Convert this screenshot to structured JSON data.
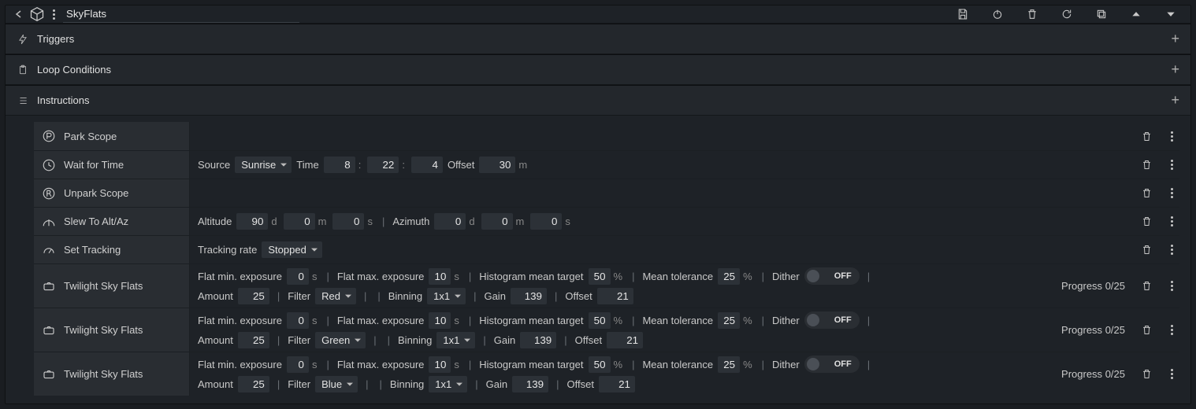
{
  "title": "SkyFlats",
  "sections": {
    "triggers": "Triggers",
    "loop": "Loop Conditions",
    "instructions": "Instructions"
  },
  "labels": {
    "source": "Source",
    "time": "Time",
    "offset": "Offset",
    "altitude": "Altitude",
    "azimuth": "Azimuth",
    "tracking_rate": "Tracking rate",
    "flat_min": "Flat min. exposure",
    "flat_max": "Flat max. exposure",
    "hist_mean": "Histogram mean target",
    "mean_tol": "Mean tolerance",
    "dither": "Dither",
    "amount": "Amount",
    "filter": "Filter",
    "binning": "Binning",
    "gain": "Gain",
    "progress": "Progress",
    "off": "OFF"
  },
  "rows": {
    "park": {
      "title": "Park Scope"
    },
    "wait": {
      "title": "Wait for Time",
      "source": "Sunrise",
      "h": "8",
      "m": "22",
      "s": "4",
      "offset": "30",
      "offset_unit": "m"
    },
    "unpark": {
      "title": "Unpark Scope"
    },
    "slew": {
      "title": "Slew To Alt/Az",
      "alt_d": "90",
      "alt_m": "0",
      "alt_s": "0",
      "az_d": "0",
      "az_m": "0",
      "az_s": "0"
    },
    "tracking": {
      "title": "Set Tracking",
      "rate": "Stopped"
    },
    "twi": [
      {
        "title": "Twilight Sky Flats",
        "min": "0",
        "max": "10",
        "hist": "50",
        "tol": "25",
        "amount": "25",
        "filter": "Red",
        "binning": "1x1",
        "gain": "139",
        "offset": "21",
        "progress": "0/25"
      },
      {
        "title": "Twilight Sky Flats",
        "min": "0",
        "max": "10",
        "hist": "50",
        "tol": "25",
        "amount": "25",
        "filter": "Green",
        "binning": "1x1",
        "gain": "139",
        "offset": "21",
        "progress": "0/25"
      },
      {
        "title": "Twilight Sky Flats",
        "min": "0",
        "max": "10",
        "hist": "50",
        "tol": "25",
        "amount": "25",
        "filter": "Blue",
        "binning": "1x1",
        "gain": "139",
        "offset": "21",
        "progress": "0/25"
      }
    ]
  }
}
